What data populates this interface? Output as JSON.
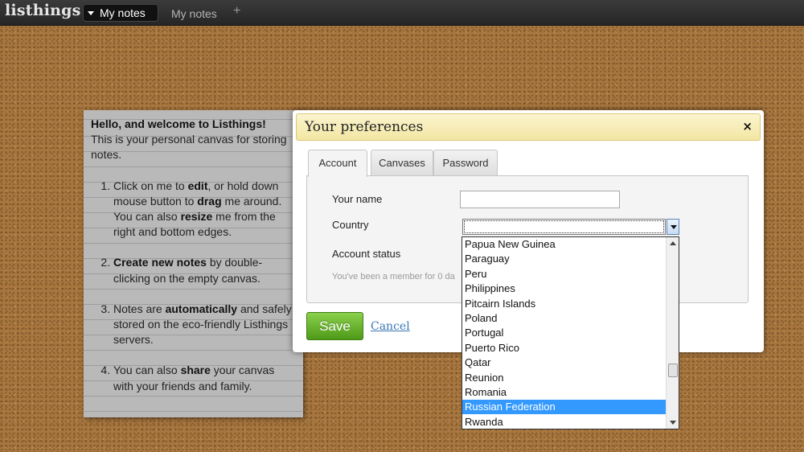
{
  "topbar": {
    "logo": "listhings",
    "active_tab": "My notes",
    "tab2": "My notes",
    "add_tab": "+"
  },
  "note": {
    "welcome_title": "Hello, and welcome to Listhings!",
    "intro": "This is your personal canvas for storing notes.",
    "item1": {
      "a": "Click on me to ",
      "b": "edit",
      "c": ", or hold down mouse button to ",
      "d": "drag",
      "e": " me around. You can also ",
      "f": "resize",
      "g": " me from the right and bottom edges."
    },
    "item2": {
      "a": "Create new notes",
      "b": " by double-clicking on the empty canvas."
    },
    "item3": {
      "a": "Notes are ",
      "b": "automatically",
      "c": " and safely stored on the eco-friendly Listhings servers."
    },
    "item4": {
      "a": "You can also ",
      "b": "share",
      "c": " your canvas with your friends and family."
    }
  },
  "dialog": {
    "title": "Your preferences",
    "close": "×",
    "tabs": [
      "Account",
      "Canvases",
      "Password"
    ],
    "labels": {
      "name": "Your name",
      "country": "Country",
      "status": "Account status"
    },
    "name_value": "",
    "country_value": "",
    "member_text": "You've been a member for 0 da",
    "save": "Save",
    "cancel": "Cancel"
  },
  "dropdown": {
    "options": [
      "Papua New Guinea",
      "Paraguay",
      "Peru",
      "Philippines",
      "Pitcairn Islands",
      "Poland",
      "Portugal",
      "Puerto Rico",
      "Qatar",
      "Reunion",
      "Romania",
      "Russian Federation",
      "Rwanda"
    ],
    "selected": "Russian Federation"
  },
  "colors": {
    "selected_option": "#3399ff",
    "save_button": "#5fae28",
    "header_bg": "#f3e6a3"
  }
}
